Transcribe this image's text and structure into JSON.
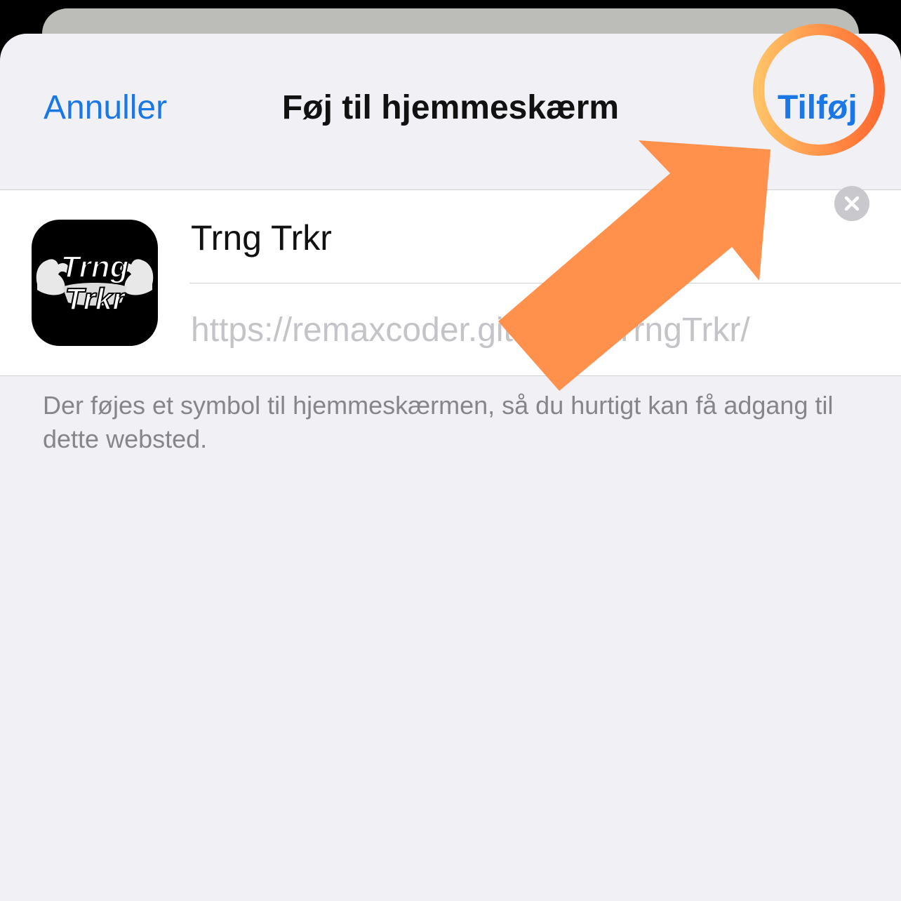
{
  "header": {
    "cancel_label": "Annuller",
    "title": "Føj til hjemmeskærm",
    "add_label": "Tilføj"
  },
  "app": {
    "icon_text_line1": "Trng",
    "icon_text_line2": "Trkr",
    "name_value": "Trng Trkr",
    "url": "https://remaxcoder.github.io/TrngTrkr/"
  },
  "footer": {
    "note": "Der føjes et symbol til hjemmeskærmen, så du hurtigt kan få adgang til dette websted."
  },
  "colors": {
    "accent_blue": "#1a78e6",
    "highlight_orange": "#ff914d"
  },
  "icons": {
    "clear": "clear-circle-x-icon",
    "app": "flexing-arms-logo"
  }
}
